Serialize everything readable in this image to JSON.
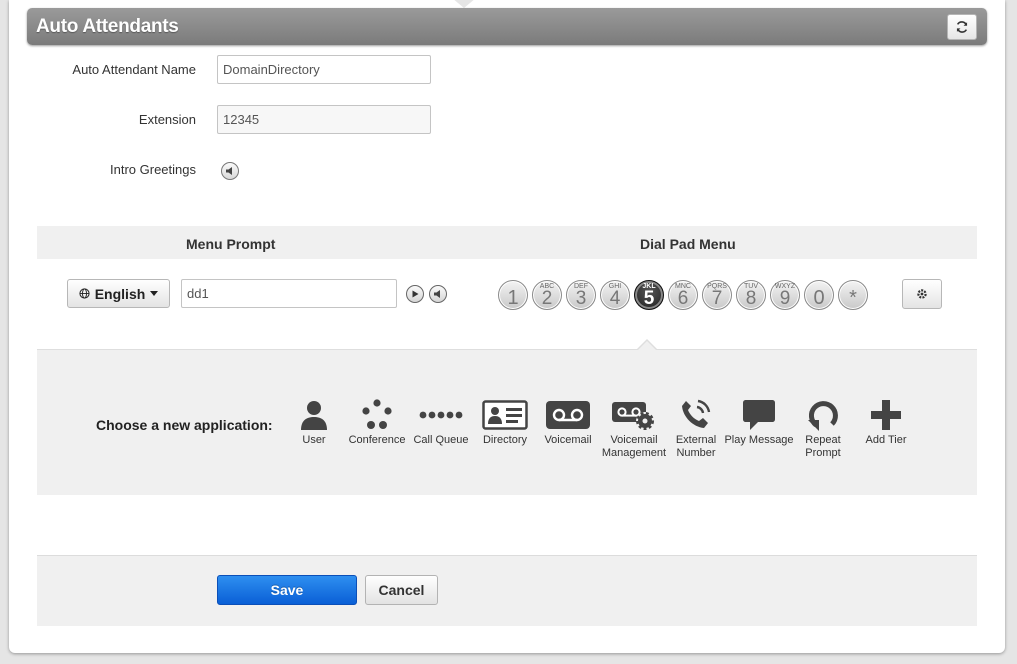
{
  "header": {
    "title": "Auto Attendants",
    "refresh_icon": "refresh-icon"
  },
  "form": {
    "name_label": "Auto Attendant Name",
    "name_value": "DomainDirectory",
    "extension_label": "Extension",
    "extension_value": "12345",
    "intro_label": "Intro Greetings"
  },
  "menu": {
    "prompt_heading": "Menu Prompt",
    "dialpad_heading": "Dial Pad Menu",
    "language": "English",
    "prompt_value": "dd1"
  },
  "dialpad": {
    "keys": [
      {
        "digit": "1",
        "letters": ""
      },
      {
        "digit": "2",
        "letters": "ABC"
      },
      {
        "digit": "3",
        "letters": "DEF"
      },
      {
        "digit": "4",
        "letters": "GHI"
      },
      {
        "digit": "5",
        "letters": "JKL",
        "active": true
      },
      {
        "digit": "6",
        "letters": "MNC"
      },
      {
        "digit": "7",
        "letters": "PQRS"
      },
      {
        "digit": "8",
        "letters": "TUV"
      },
      {
        "digit": "9",
        "letters": "WXYZ"
      },
      {
        "digit": "0",
        "letters": ""
      },
      {
        "digit": "*",
        "letters": ""
      }
    ]
  },
  "applications": {
    "label": "Choose a new application:",
    "items": [
      {
        "label": "User",
        "icon": "user-icon"
      },
      {
        "label": "Conference",
        "icon": "conference-icon"
      },
      {
        "label": "Call Queue",
        "icon": "call-queue-icon"
      },
      {
        "label": "Directory",
        "icon": "directory-icon"
      },
      {
        "label": "Voicemail",
        "icon": "voicemail-icon"
      },
      {
        "label": "Voicemail Management",
        "icon": "voicemail-management-icon"
      },
      {
        "label": "External Number",
        "icon": "external-number-icon"
      },
      {
        "label": "Play Message",
        "icon": "play-message-icon"
      },
      {
        "label": "Repeat Prompt",
        "icon": "repeat-prompt-icon"
      },
      {
        "label": "Add Tier",
        "icon": "add-tier-icon"
      }
    ]
  },
  "actions": {
    "save_label": "Save",
    "cancel_label": "Cancel"
  },
  "colors": {
    "primary": "#0a5fd6",
    "header_bg": "#8a8a8a",
    "active_key": "#1c1c1c"
  }
}
